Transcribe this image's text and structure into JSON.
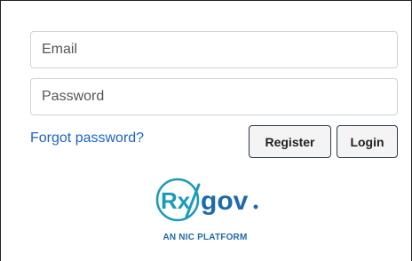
{
  "form": {
    "email_placeholder": "Email",
    "password_placeholder": "Password",
    "forgot_password": "Forgot password?",
    "register_label": "Register",
    "login_label": "Login"
  },
  "logo": {
    "rx": "Rx",
    "gov": "gov",
    "tagline": "AN NIC PLATFORM"
  },
  "colors": {
    "link": "#1a64c8",
    "logo_teal": "#1a9bb8",
    "logo_blue": "#1f6aa8",
    "button_border": "#2c3a4d"
  }
}
